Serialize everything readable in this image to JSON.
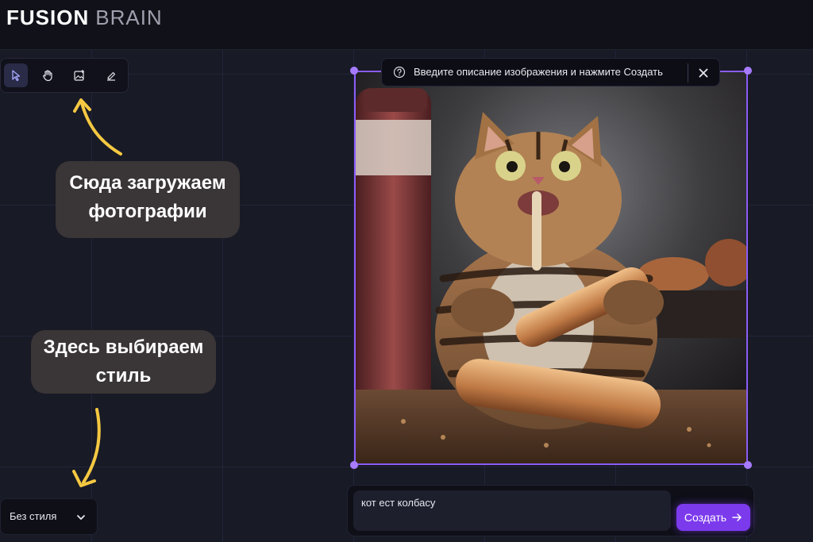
{
  "header": {
    "logo_bold": "FUSION",
    "logo_light": "BRAIN"
  },
  "toolbar": {
    "tools": [
      "select-arrow-icon",
      "hand-icon",
      "image-upload-icon",
      "eraser-icon"
    ],
    "active": "select-arrow-icon"
  },
  "tooltip": {
    "text": "Введите описание изображения и нажмите Создать"
  },
  "annotations": {
    "upload": "Сюда загружаем фотографии",
    "style": "Здесь выбираем стиль"
  },
  "prompt": {
    "value": "кот ест колбасу"
  },
  "create_button": {
    "label": "Создать"
  },
  "style_select": {
    "value": "Без стиля"
  },
  "colors": {
    "accent": "#7c3aed",
    "arrow": "#f5c842",
    "annotation_bg": "#3a3536"
  }
}
